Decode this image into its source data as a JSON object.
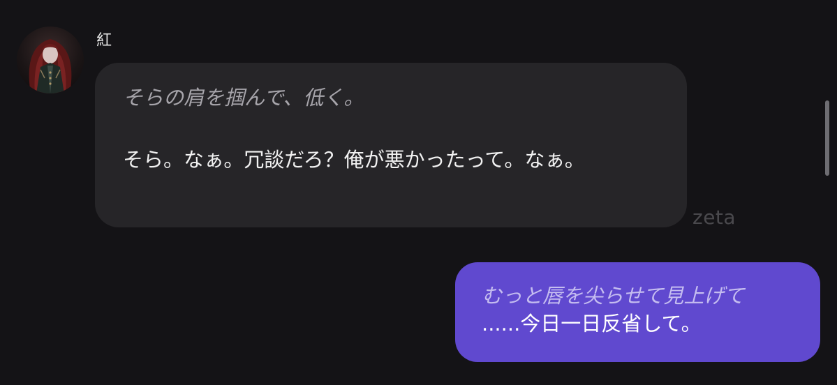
{
  "chat": {
    "bot": {
      "name": "紅",
      "action": "そらの肩を掴んで、低く。",
      "speech": "そら。なぁ。冗談だろ？俺が悪かったって。なぁ。"
    },
    "watermark": "zeta",
    "user": {
      "action": "むっと唇を尖らせて見上げて",
      "speech": "......今日一日反省して。"
    }
  },
  "colors": {
    "background": "#141316",
    "bot_bubble": "#262528",
    "user_bubble": "#6049cf",
    "scrollbar": "#6e6d72"
  },
  "icons": {
    "avatar": "character-portrait"
  }
}
